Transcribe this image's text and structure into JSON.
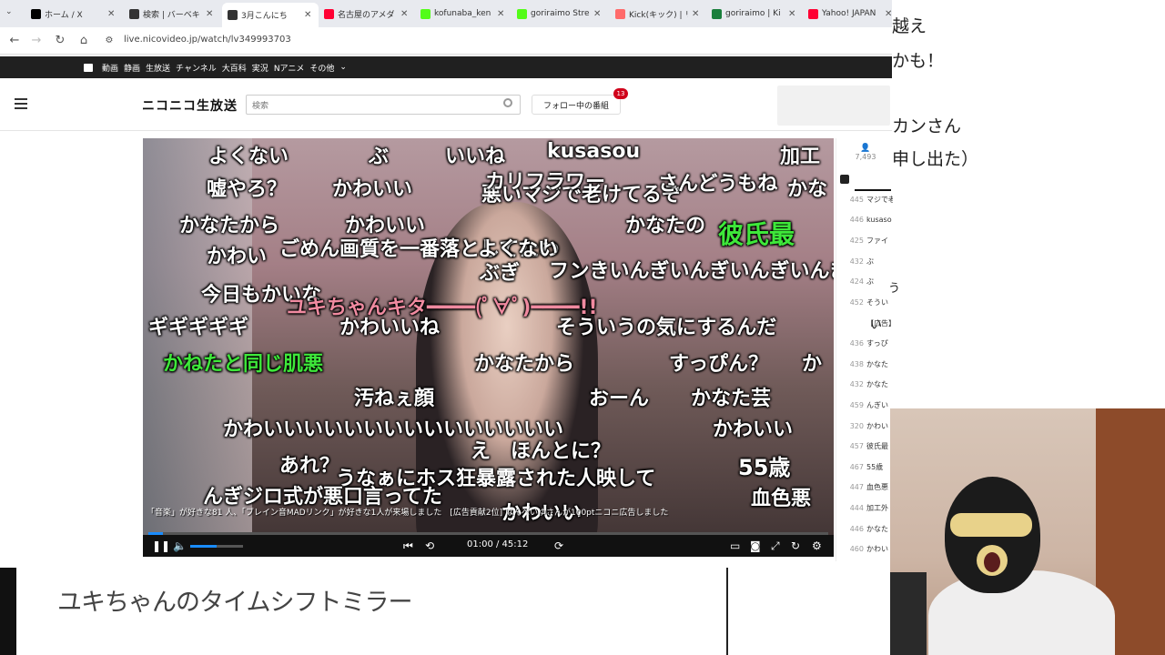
{
  "browser": {
    "tabs": [
      {
        "label": "ホーム / X",
        "favicon": "x-logo-icon",
        "color": "#000000"
      },
      {
        "label": "検索 | バーベキ",
        "favicon": "nicovideo-icon",
        "color": "#333333"
      },
      {
        "label": "3月こんにち",
        "favicon": "nicolive-icon",
        "color": "#333333",
        "active": true
      },
      {
        "label": "名古屋のアメダ",
        "favicon": "yahoo-icon",
        "color": "#ff0033"
      },
      {
        "label": "kofunaba_ken",
        "favicon": "kick-icon",
        "color": "#53fc18"
      },
      {
        "label": "goriraimo Stre",
        "favicon": "kick-icon",
        "color": "#53fc18"
      },
      {
        "label": "Kick(キック) | リ",
        "favicon": "kick-stream-icon",
        "color": "#ff6b6b"
      },
      {
        "label": "goriraimo | Ki",
        "favicon": "kick-icon",
        "color": "#1a7f3c"
      },
      {
        "label": "Yahoo! JAPAN",
        "favicon": "yahoo-icon",
        "color": "#ff0033"
      }
    ],
    "url": "live.nicovideo.jp/watch/lv349993703"
  },
  "niconav": {
    "items": [
      "動画",
      "静画",
      "生放送",
      "チャンネル",
      "大百科",
      "実況",
      "Nアニメ",
      "その他"
    ]
  },
  "header": {
    "logo": "ニコニコ生放送",
    "search_placeholder": "検索",
    "follow_label": "フォロー中の番組",
    "follow_badge": "13"
  },
  "player": {
    "comments": [
      {
        "text": "よくない",
        "style": "white"
      },
      {
        "text": "ぶ",
        "style": "white"
      },
      {
        "text": "いいね",
        "style": "white"
      },
      {
        "text": "kusasou",
        "style": "white"
      },
      {
        "text": "加工",
        "style": "white"
      },
      {
        "text": "嘘やろ？",
        "style": "white"
      },
      {
        "text": "かわいい",
        "style": "white"
      },
      {
        "text": "悪いマジで老けてるぞ",
        "style": "white"
      },
      {
        "text": "カリフラワー",
        "style": "white"
      },
      {
        "text": "さんどうもね",
        "style": "white"
      },
      {
        "text": "かな",
        "style": "white"
      },
      {
        "text": "かなたから",
        "style": "white"
      },
      {
        "text": "かわいい",
        "style": "white"
      },
      {
        "text": "かなたの",
        "style": "white"
      },
      {
        "text": "彼氏最",
        "style": "green"
      },
      {
        "text": "かわい",
        "style": "white"
      },
      {
        "text": "ごめん画質を一番落としてたわ",
        "style": "white"
      },
      {
        "text": "よくない",
        "style": "white"
      },
      {
        "text": "ぶぎ",
        "style": "white"
      },
      {
        "text": "フンきいんぎいんぎいんぎいんぎ",
        "style": "white"
      },
      {
        "text": "今日もかいな",
        "style": "white"
      },
      {
        "text": "ユキちゃんキタ━━━━(ﾟ∀ﾟ)━━━━!!",
        "style": "pink"
      },
      {
        "text": "ギギギギギ",
        "style": "white"
      },
      {
        "text": "かわいいね",
        "style": "white"
      },
      {
        "text": "そういうの気にするんだ",
        "style": "white"
      },
      {
        "text": "かねたと同じ肌悪",
        "style": "green"
      },
      {
        "text": "かなたから",
        "style": "white"
      },
      {
        "text": "すっぴん？",
        "style": "white"
      },
      {
        "text": "か",
        "style": "white"
      },
      {
        "text": "汚ねぇ顔",
        "style": "white"
      },
      {
        "text": "おーん",
        "style": "white"
      },
      {
        "text": "かなた芸",
        "style": "white"
      },
      {
        "text": "かわいいいいいいいいいいいいいいい",
        "style": "white"
      },
      {
        "text": "かわいい",
        "style": "white"
      },
      {
        "text": "え　ほんとに？",
        "style": "white"
      },
      {
        "text": "あれ？",
        "style": "white"
      },
      {
        "text": "55歳",
        "style": "white"
      },
      {
        "text": "うなぁにホス狂暴露された人映して",
        "style": "white"
      },
      {
        "text": "血色悪",
        "style": "white"
      },
      {
        "text": "んぎジロ式が悪口言ってた",
        "style": "white"
      },
      {
        "text": "かわいい",
        "style": "white"
      }
    ],
    "ticker": "「音楽」が好きな81 人、「ブレイン音MADリンク」が好きな1人が来場しました　[広告貢献2位] はんぺいゆさんが100ptニコニ広告しました",
    "progress": 0.022,
    "volume": 0.5,
    "time": "01:00 / 45:12"
  },
  "side_panel": {
    "viewers": "7,493",
    "comments": [
      {
        "no": "445",
        "text": "マジで老"
      },
      {
        "no": "446",
        "text": "kusaso"
      },
      {
        "no": "425",
        "text": "ファイ"
      },
      {
        "no": "432",
        "text": "ぶ"
      },
      {
        "no": "424",
        "text": "ぶ"
      },
      {
        "no": "452",
        "text": "そうい"
      },
      {
        "no": "",
        "text": "【広告】"
      },
      {
        "no": "436",
        "text": "すっぴ"
      },
      {
        "no": "438",
        "text": "かなた"
      },
      {
        "no": "432",
        "text": "かなた"
      },
      {
        "no": "459",
        "text": "んぎい"
      },
      {
        "no": "320",
        "text": "かわい"
      },
      {
        "no": "457",
        "text": "彼氏最"
      },
      {
        "no": "467",
        "text": "55歳"
      },
      {
        "no": "447",
        "text": "血色悪"
      },
      {
        "no": "444",
        "text": "加工外"
      },
      {
        "no": "446",
        "text": "かなた"
      },
      {
        "no": "460",
        "text": "かわい"
      }
    ]
  },
  "overlay_right": [
    "越え",
    "かも！",
    "カンさん",
    "申し出た）",
    "う",
    "い"
  ],
  "bottom": {
    "title": "ユキちゃんのタイムシフトミラー"
  },
  "colors": {
    "accent": "#1a8cff",
    "badge": "#d0021b",
    "comment_green": "#3ee83a"
  }
}
